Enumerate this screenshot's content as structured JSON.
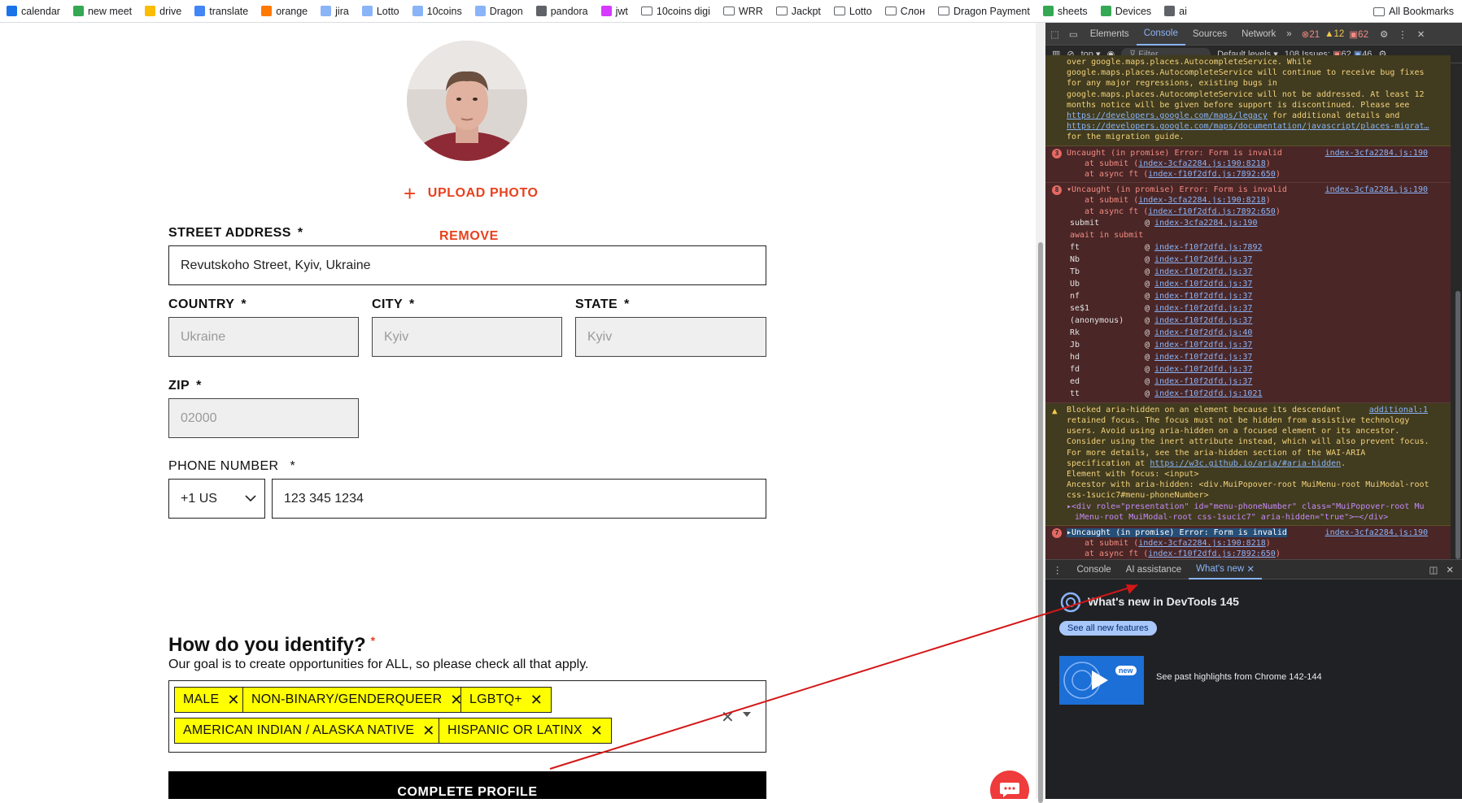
{
  "bookmarks": [
    {
      "label": "calendar",
      "color": "#1a73e8"
    },
    {
      "label": "new meet",
      "color": "#34a853"
    },
    {
      "label": "drive",
      "color": "#fbbc04"
    },
    {
      "label": "translate",
      "color": "#4285f4"
    },
    {
      "label": "orange",
      "color": "#ff7900"
    },
    {
      "label": "jira",
      "color": "#8ab4f8"
    },
    {
      "label": "Lotto",
      "color": "#8ab4f8"
    },
    {
      "label": "10coins",
      "color": "#8ab4f8"
    },
    {
      "label": "Dragon",
      "color": "#8ab4f8"
    },
    {
      "label": "pandora",
      "color": "#5f6368"
    },
    {
      "label": "jwt",
      "color": "#d63aff"
    },
    {
      "label": "10coins digi",
      "color": "folder"
    },
    {
      "label": "WRR",
      "color": "folder"
    },
    {
      "label": "Jackpt",
      "color": "folder"
    },
    {
      "label": "Lotto",
      "color": "folder"
    },
    {
      "label": "Слон",
      "color": "folder"
    },
    {
      "label": "Dragon Payment",
      "color": "folder"
    },
    {
      "label": "sheets",
      "color": "#34a853"
    },
    {
      "label": "Devices",
      "color": "#34a853"
    },
    {
      "label": "ai",
      "color": "#5f6368"
    }
  ],
  "all_bookmarks": "All Bookmarks",
  "form": {
    "upload_photo": "UPLOAD PHOTO",
    "remove": "REMOVE",
    "street_label": "STREET ADDRESS",
    "street_value": "Revutskoho Street, Kyiv, Ukraine",
    "country_label": "COUNTRY",
    "country_value": "Ukraine",
    "city_label": "CITY",
    "city_value": "Kyiv",
    "state_label": "STATE",
    "state_value": "Kyiv",
    "zip_label": "ZIP",
    "zip_value": "02000",
    "phone_label": "PHONE NUMBER",
    "phone_code": "+1 US",
    "phone_value": "123 345 1234",
    "required": "*",
    "identify_question": "How do you identify?",
    "identify_sub": "Our goal is to create opportunities for ALL, so please check all that apply.",
    "chips": [
      "MALE",
      "NON-BINARY/GENDERQUEER",
      "LGBTQ+",
      "AMERICAN INDIAN / ALASKA NATIVE",
      "HISPANIC OR LATINX"
    ],
    "chip_remove": "✕",
    "clear_all": "✕",
    "submit": "COMPLETE PROFILE",
    "accent_color": "#e8401c",
    "chip_color": "#ffff00"
  },
  "devtools": {
    "tabs": [
      "Elements",
      "Console",
      "Sources",
      "Network"
    ],
    "active_tab": "Console",
    "more_tabs": "»",
    "counts": {
      "errors": "21",
      "warnings": "12",
      "issues_badge": "62"
    },
    "toolbar": {
      "context": "top ▾",
      "filter": "Filter",
      "levels": "Default levels ▾",
      "issues": "108 Issues:",
      "issues_err": "62",
      "issues_info": "46"
    },
    "warn1_lines": [
      "over google.maps.places.AutocompleteService. While",
      "google.maps.places.AutocompleteService will continue to receive bug fixes",
      "for any major regressions, existing bugs in",
      "google.maps.places.AutocompleteService will not be addressed. At least 12",
      "months notice will be given before support is discontinued. Please see"
    ],
    "warn1_link1": "https://developers.google.com/maps/legacy",
    "warn1_after1": " for additional details and",
    "warn1_link2": "https://developers.google.com/maps/documentation/javascript/places-migrat…",
    "warn1_last": "for the migration guide.",
    "err1": {
      "count": "3",
      "text": "Uncaught (in promise) Error: Form is invalid",
      "src": "index-3cfa2284.js:190",
      "at1_pre": "at submit (",
      "at1": "index-3cfa2284.js:190:8218",
      "at2_pre": "at async ft (",
      "at2": "index-f10f2dfd.js:7892:650",
      "close": ")"
    },
    "err2": {
      "count": "8",
      "text": "▾Uncaught (in promise) Error: Form is invalid",
      "src": "index-3cfa2284.js:190",
      "at1": "index-3cfa2284.js:190:8218",
      "at2": "index-f10f2dfd.js:7892:650",
      "stack_top": [
        [
          "submit",
          "index-3cfa2284.js:190"
        ]
      ],
      "await_label": "await in submit",
      "stack": [
        [
          "ft",
          "index-f10f2dfd.js:7892"
        ],
        [
          "Nb",
          "index-f10f2dfd.js:37"
        ],
        [
          "Tb",
          "index-f10f2dfd.js:37"
        ],
        [
          "Ub",
          "index-f10f2dfd.js:37"
        ],
        [
          "nf",
          "index-f10f2dfd.js:37"
        ],
        [
          "se$1",
          "index-f10f2dfd.js:37"
        ],
        [
          "(anonymous)",
          "index-f10f2dfd.js:37"
        ],
        [
          "Rk",
          "index-f10f2dfd.js:40"
        ],
        [
          "Jb",
          "index-f10f2dfd.js:37"
        ],
        [
          "hd",
          "index-f10f2dfd.js:37"
        ],
        [
          "fd",
          "index-f10f2dfd.js:37"
        ],
        [
          "ed",
          "index-f10f2dfd.js:37"
        ],
        [
          "tt",
          "index-f10f2dfd.js:1021"
        ]
      ]
    },
    "warn2": {
      "src": "additional:1",
      "lines": [
        "Blocked aria-hidden on an element because its descendant",
        "retained focus. The focus must not be hidden from assistive technology",
        "users. Avoid using aria-hidden on a focused element or its ancestor.",
        "Consider using the inert attribute instead, which will also prevent focus.",
        "For more details, see the aria-hidden section of the WAI-ARIA"
      ],
      "spec_pre": "specification at ",
      "spec_link": "https://w3c.github.io/aria/#aria-hidden",
      "spec_post": ".",
      "focus": "Element with focus: <input>",
      "ancestor1": "Ancestor with aria-hidden: <div.MuiPopover-root MuiMenu-root MuiModal-root",
      "ancestor2": "css-1sucic7#menu-phoneNumber>",
      "div1": "▸<div role=\"presentation\" id=\"menu-phoneNumber\" class=\"MuiPopover-root Mu",
      "div2": "iMenu-root MuiModal-root css-1sucic7\" aria-hidden=\"true\">⋯</div>"
    },
    "err3": {
      "count": "7",
      "text": "▸Uncaught (in promise) Error: Form is invalid",
      "src": "index-3cfa2284.js:190",
      "at1": "index-3cfa2284.js:190:8218",
      "at2": "index-f10f2dfd.js:7892:650"
    },
    "prompt": "›",
    "drawer_tabs": [
      "Console",
      "AI assistance",
      "What's new"
    ],
    "whats_new_title": "What's new in DevTools 145",
    "see_all": "See all new features",
    "past_highlights": "See past highlights from Chrome 142-144",
    "new_tag": "new"
  }
}
